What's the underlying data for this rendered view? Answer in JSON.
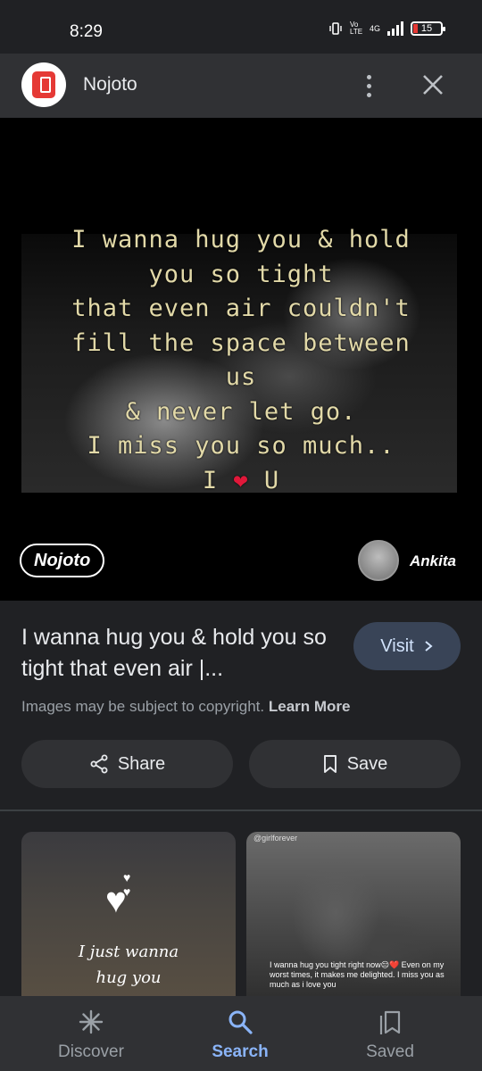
{
  "status_bar": {
    "time": "8:29",
    "network": "4G",
    "volte": "Vo LTE",
    "battery": "15"
  },
  "header": {
    "site_name": "Nojoto",
    "more_icon": "more-vert-icon",
    "close_icon": "close-icon"
  },
  "image": {
    "quote_lines": [
      "I wanna hug you & hold",
      "you so tight",
      "that even air couldn't",
      "fill the space between",
      "us",
      "& never let go.",
      "I miss you so much..",
      "I ❤ U"
    ],
    "watermark_left": "Nojoto",
    "watermark_right": "Ankita"
  },
  "result": {
    "title": "I wanna hug you & hold you so tight that even air |...",
    "visit_label": "Visit",
    "copyright_text": "Images may be subject to copyright.",
    "learn_more": "Learn More",
    "share_label": "Share",
    "save_label": "Save"
  },
  "related": [
    {
      "text_line1": "I just wanna",
      "text_line2": "hug you"
    },
    {
      "tag": "@girlforever",
      "text": "I wanna hug you tight right now😔❤️ Even on my worst times, it makes me delighted. I miss you as much as i love you"
    }
  ],
  "bottom_nav": {
    "discover": "Discover",
    "search": "Search",
    "saved": "Saved",
    "active": "search",
    "accent_color": "#8ab4f8"
  }
}
